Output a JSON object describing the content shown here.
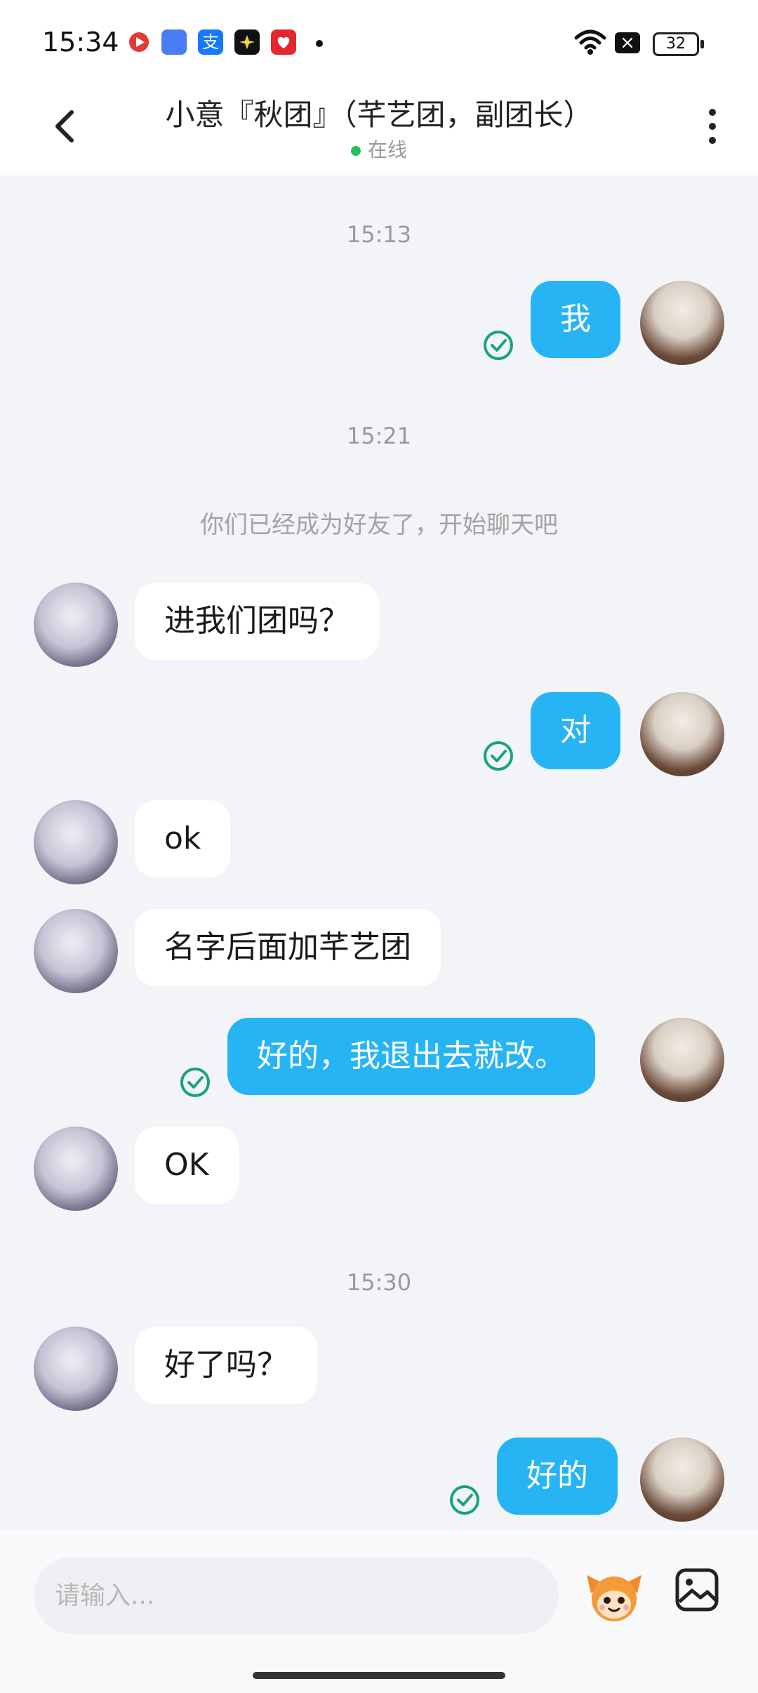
{
  "status_bar": {
    "time": "15:34",
    "battery": "32"
  },
  "header": {
    "title": "小意『秋团』（芊艺团，副团长）",
    "status": "在线"
  },
  "messages": {
    "t1": "15:13",
    "m1": "我",
    "t2": "15:21",
    "notice": "你们已经成为好友了，开始聊天吧",
    "m2": "进我们团吗？",
    "m3": "对",
    "m4": "ok",
    "m5": "名字后面加芊艺团",
    "m6": "好的，我退出去就改。",
    "m7": "OK",
    "t3": "15:30",
    "m8": "好了吗？",
    "m9": "好的"
  },
  "composer": {
    "placeholder": "请输入..."
  },
  "colors": {
    "outgoing": "#27b4f5",
    "incoming": "#ffffff",
    "online": "#22c05a",
    "check": "#1aa37a"
  }
}
